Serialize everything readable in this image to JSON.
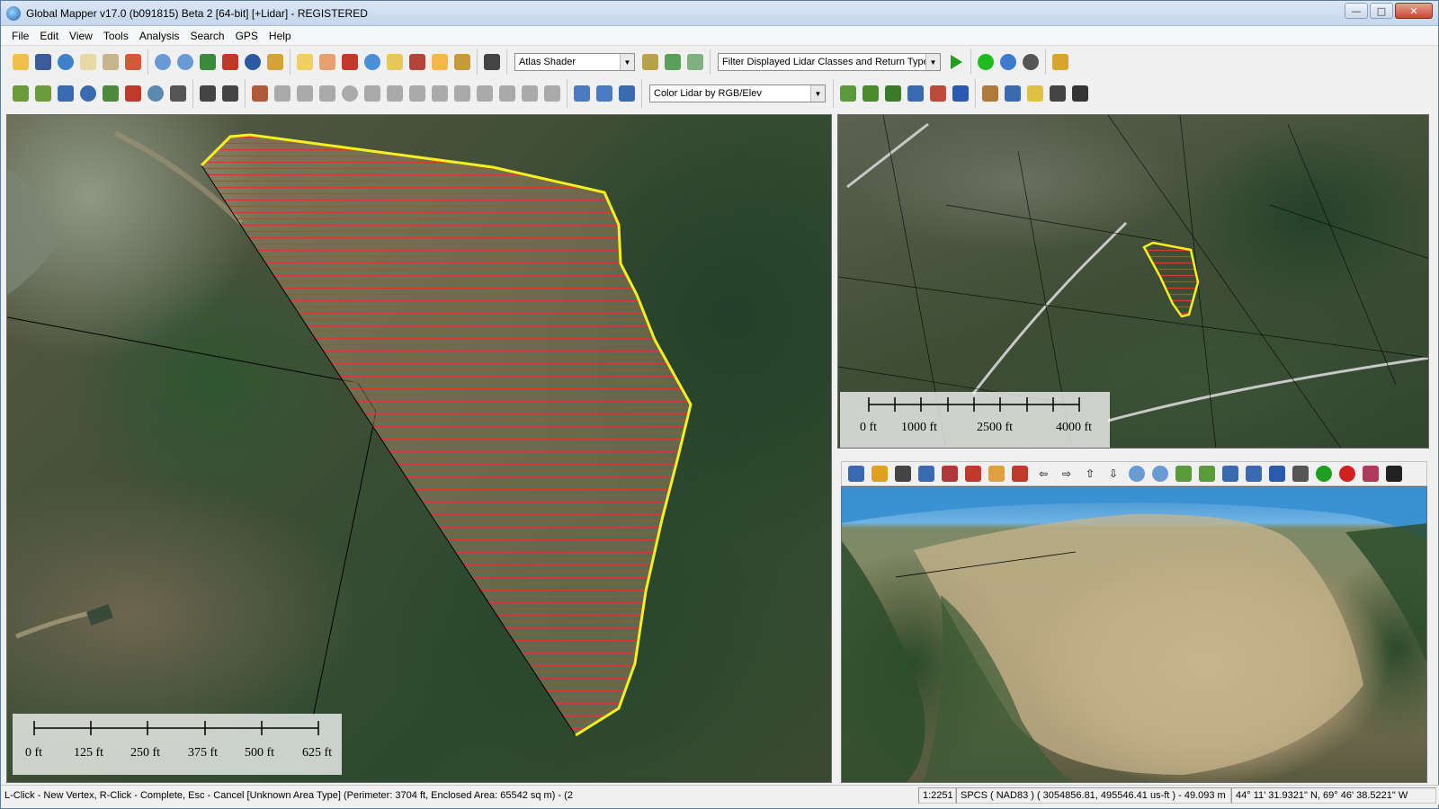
{
  "window": {
    "title": "Global Mapper v17.0 (b091815) Beta 2 [64-bit] [+Lidar] - REGISTERED",
    "controls": {
      "minimize": "—",
      "maximize": "□",
      "close": "✕"
    }
  },
  "menu": [
    "File",
    "Edit",
    "View",
    "Tools",
    "Analysis",
    "Search",
    "GPS",
    "Help"
  ],
  "toolbar1": {
    "shader_select": "Atlas Shader",
    "lidar_filter_select": "Filter Displayed Lidar Classes and Return Types"
  },
  "toolbar2": {
    "lidar_color_select": "Color Lidar by RGB/Elev"
  },
  "main_map": {
    "scale_labels": [
      "0 ft",
      "125 ft",
      "250 ft",
      "375 ft",
      "500 ft",
      "625 ft"
    ]
  },
  "overview_map": {
    "scale_labels": [
      "0 ft",
      "1000 ft",
      "2500 ft",
      "4000 ft"
    ]
  },
  "status": {
    "message": "L-Click - New Vertex, R-Click - Complete, Esc - Cancel [Unknown Area Type] (Perimeter: 3704 ft, Enclosed Area: 65542 sq m) - (2",
    "scale": "1:2251",
    "projection": "SPCS ( NAD83 ) ( 3054856.81, 495546.41 us-ft ) - 49.093 m",
    "latlon": "44° 11' 31.9321\" N, 69° 46' 38.5221\" W"
  },
  "colors": {
    "polygon_outline": "#f5f01e",
    "polygon_hatch": "#d83a2a",
    "title_bar": "#c4d6ec"
  }
}
